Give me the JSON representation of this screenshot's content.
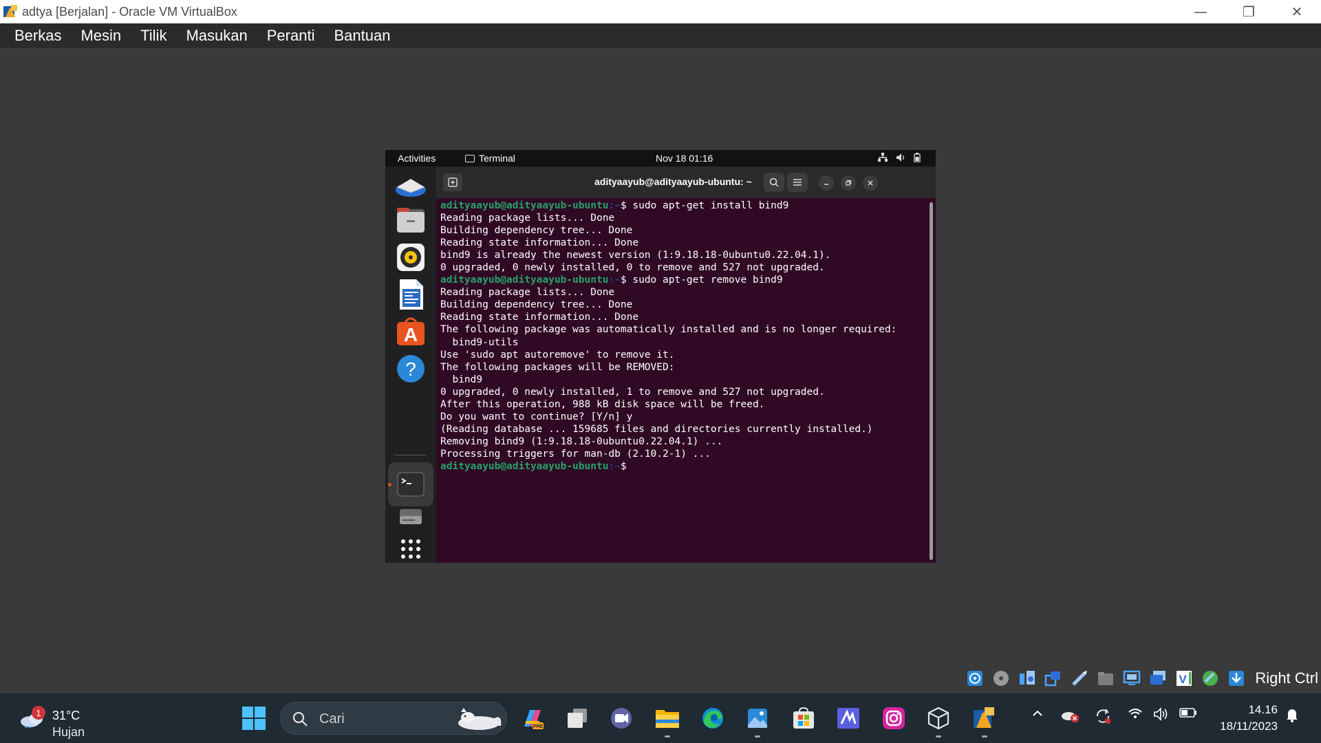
{
  "window": {
    "title": "adtya [Berjalan] - Oracle VM VirtualBox",
    "controls": {
      "minimize": "—",
      "restore": "❐",
      "close": "✕"
    }
  },
  "menubar": {
    "items": [
      "Berkas",
      "Mesin",
      "Tilik",
      "Masukan",
      "Peranti",
      "Bantuan"
    ]
  },
  "gnome": {
    "activities": "Activities",
    "app_name": "Terminal",
    "clock": "Nov 18  01:16",
    "dock_apps": [
      "thunderbird",
      "files",
      "rhythmbox",
      "libreoffice-writer",
      "app-center",
      "help",
      "terminal",
      "disk",
      "show-apps"
    ]
  },
  "terminal": {
    "title": "adityaayub@adityaayub-ubuntu: ~",
    "prompt_user": "adityaayub@adityaayub-ubuntu",
    "prompt_path": ":~",
    "lines": [
      {
        "p": true,
        "t": "$ sudo apt-get install bind9"
      },
      {
        "p": false,
        "t": "Reading package lists... Done"
      },
      {
        "p": false,
        "t": "Building dependency tree... Done"
      },
      {
        "p": false,
        "t": "Reading state information... Done"
      },
      {
        "p": false,
        "t": "bind9 is already the newest version (1:9.18.18-0ubuntu0.22.04.1)."
      },
      {
        "p": false,
        "t": "0 upgraded, 0 newly installed, 0 to remove and 527 not upgraded."
      },
      {
        "p": true,
        "t": "$ sudo apt-get remove bind9"
      },
      {
        "p": false,
        "t": "Reading package lists... Done"
      },
      {
        "p": false,
        "t": "Building dependency tree... Done"
      },
      {
        "p": false,
        "t": "Reading state information... Done"
      },
      {
        "p": false,
        "t": "The following package was automatically installed and is no longer required:"
      },
      {
        "p": false,
        "t": "  bind9-utils"
      },
      {
        "p": false,
        "t": "Use 'sudo apt autoremove' to remove it."
      },
      {
        "p": false,
        "t": "The following packages will be REMOVED:"
      },
      {
        "p": false,
        "t": "  bind9"
      },
      {
        "p": false,
        "t": "0 upgraded, 0 newly installed, 1 to remove and 527 not upgraded."
      },
      {
        "p": false,
        "t": "After this operation, 988 kB disk space will be freed."
      },
      {
        "p": false,
        "t": "Do you want to continue? [Y/n] y"
      },
      {
        "p": false,
        "t": "(Reading database ... 159685 files and directories currently installed.)"
      },
      {
        "p": false,
        "t": "Removing bind9 (1:9.18.18-0ubuntu0.22.04.1) ..."
      },
      {
        "p": false,
        "t": "Processing triggers for man-db (2.10.2-1) ..."
      },
      {
        "p": true,
        "t": "$ "
      }
    ]
  },
  "vm_status": {
    "icons": [
      "hard-disk",
      "optical-drive",
      "audio",
      "network",
      "usb",
      "shared-folders",
      "display",
      "recording",
      "vt-x",
      "mouse-integration",
      "keyboard"
    ],
    "host_key": "Right Ctrl"
  },
  "taskbar": {
    "weather": {
      "badge": "1",
      "temp": "31°C",
      "condition": "Hujan"
    },
    "search_placeholder": "Cari",
    "apps": [
      "start",
      "copilot",
      "task-view",
      "meet",
      "file-explorer",
      "edge",
      "photos",
      "store",
      "visual-studio",
      "instagram",
      "virtualbox-box",
      "virtualbox"
    ],
    "time": "14.16",
    "date": "18/11/2023"
  }
}
